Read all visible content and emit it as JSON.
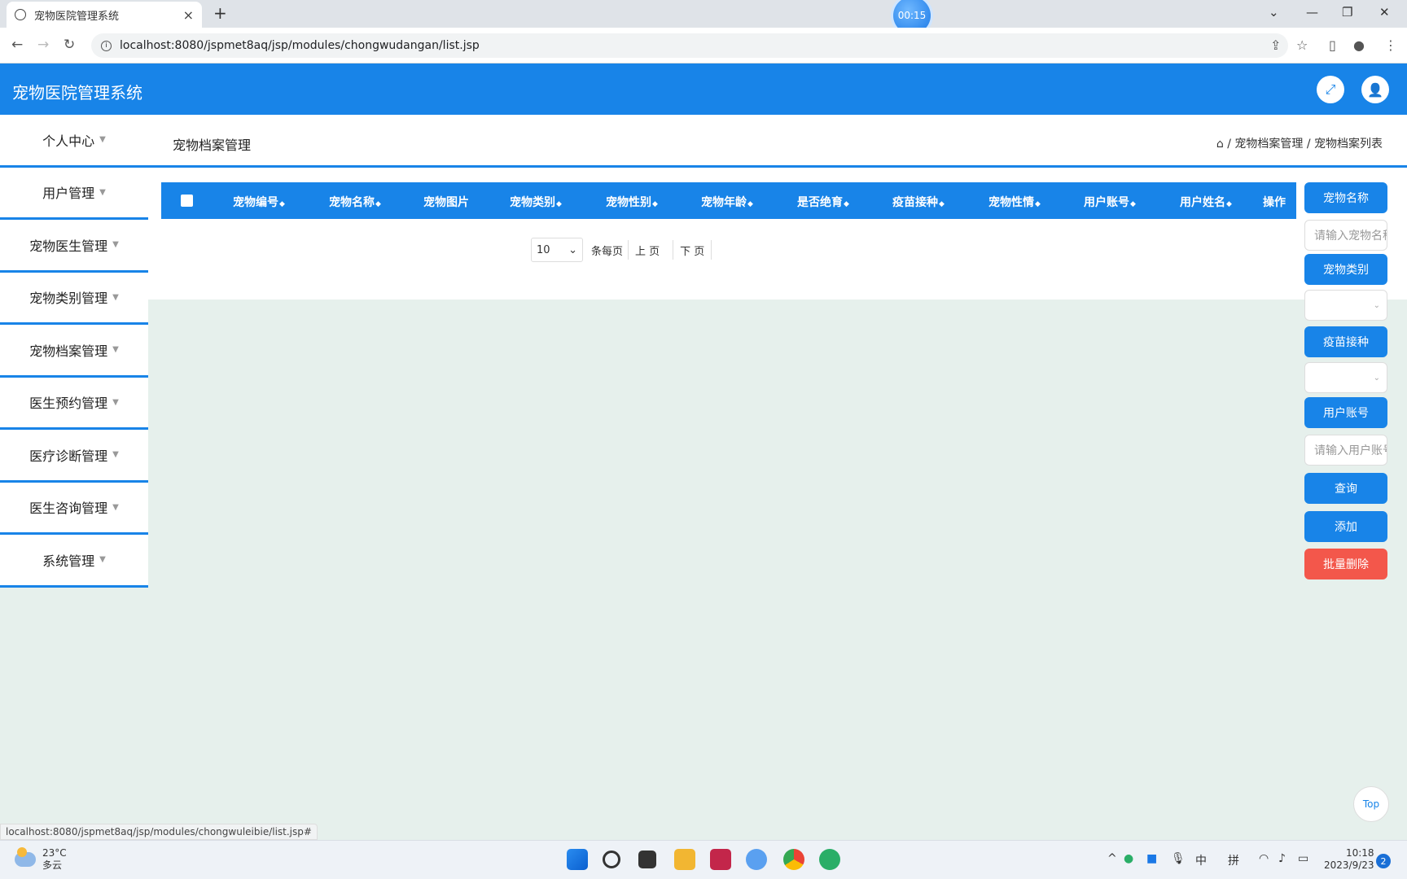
{
  "browser": {
    "tab_title": "宠物医院管理系统",
    "tab_close": "×",
    "new_tab": "+",
    "timer": "00:15",
    "url": "localhost:8080/jspmet8aq/jsp/modules/chongwudangan/list.jsp",
    "status_url": "localhost:8080/jspmet8aq/jsp/modules/chongwuleibie/list.jsp#"
  },
  "app": {
    "title": "宠物医院管理系统"
  },
  "sidebar": {
    "items": [
      {
        "label": "个人中心"
      },
      {
        "label": "用户管理"
      },
      {
        "label": "宠物医生管理"
      },
      {
        "label": "宠物类别管理"
      },
      {
        "label": "宠物档案管理"
      },
      {
        "label": "医生预约管理"
      },
      {
        "label": "医疗诊断管理"
      },
      {
        "label": "医生咨询管理"
      },
      {
        "label": "系统管理"
      }
    ]
  },
  "page": {
    "title": "宠物档案管理",
    "breadcrumb": "/ 宠物档案管理 / 宠物档案列表"
  },
  "table": {
    "columns": [
      "宠物编号",
      "宠物名称",
      "宠物图片",
      "宠物类别",
      "宠物性别",
      "宠物年龄",
      "是否绝育",
      "疫苗接种",
      "宠物性情",
      "用户账号",
      "用户姓名",
      "操作"
    ]
  },
  "pager": {
    "page_size": "10",
    "per_page_label": "条每页",
    "prev_label": "上 页",
    "next_label": "下 页"
  },
  "filters": {
    "pet_name_label": "宠物名称",
    "pet_name_placeholder": "请输入宠物名称",
    "pet_type_label": "宠物类别",
    "vaccine_label": "疫苗接种",
    "user_account_label": "用户账号",
    "user_account_placeholder": "请输入用户账号",
    "search_label": "查询",
    "add_label": "添加",
    "batch_delete_label": "批量删除"
  },
  "back_to_top": "Top",
  "taskbar": {
    "temperature": "23°C",
    "weather": "多云",
    "ime_lang": "中",
    "ime_mode": "拼",
    "time": "10:18",
    "date": "2023/9/23",
    "notifications": "2"
  },
  "colors": {
    "primary": "#1884e8",
    "danger": "#f3574b",
    "background": "#e6f0ec"
  }
}
